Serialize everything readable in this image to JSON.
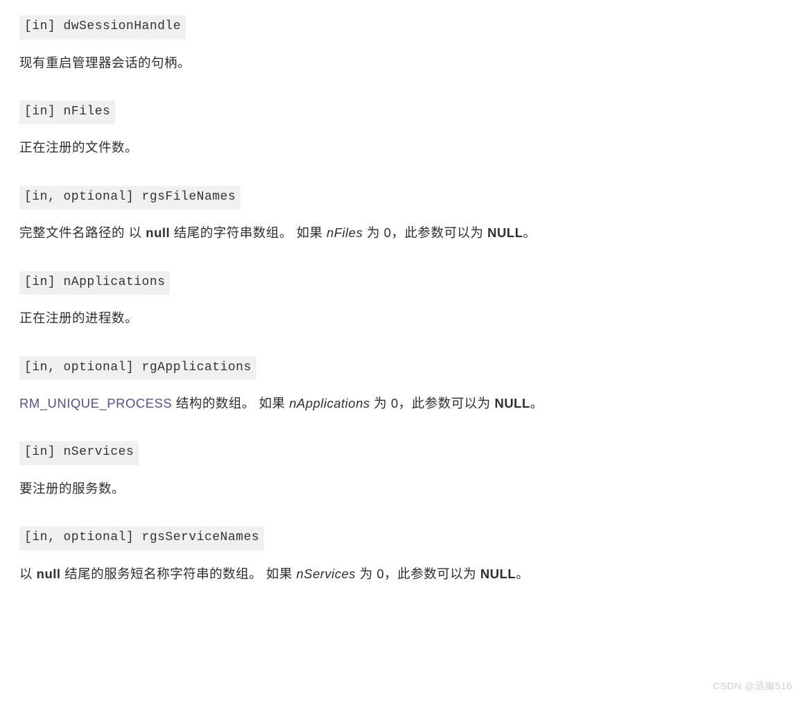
{
  "params": [
    {
      "head": "[in] dwSessionHandle",
      "desc_segments": [
        {
          "t": "现有重启管理器会话的句柄。",
          "class": ""
        }
      ]
    },
    {
      "head": "[in] nFiles",
      "desc_segments": [
        {
          "t": "正在注册的文件数。",
          "class": ""
        }
      ]
    },
    {
      "head": "[in, optional] rgsFileNames",
      "desc_segments": [
        {
          "t": "完整文件名路径的 以 ",
          "class": ""
        },
        {
          "t": "null",
          "class": "bold"
        },
        {
          "t": " 结尾的字符串数组。 如果 ",
          "class": ""
        },
        {
          "t": "nFiles",
          "class": "italic"
        },
        {
          "t": " 为 0，此参数可以为 ",
          "class": ""
        },
        {
          "t": "NULL",
          "class": "bold"
        },
        {
          "t": "。",
          "class": ""
        }
      ]
    },
    {
      "head": "[in] nApplications",
      "desc_segments": [
        {
          "t": "正在注册的进程数。",
          "class": ""
        }
      ]
    },
    {
      "head": "[in, optional] rgApplications",
      "desc_segments": [
        {
          "t": "RM_UNIQUE_PROCESS",
          "class": "plink"
        },
        {
          "t": " 结构的数组。 如果 ",
          "class": ""
        },
        {
          "t": "nApplications",
          "class": "italic"
        },
        {
          "t": " 为 0，此参数可以为 ",
          "class": ""
        },
        {
          "t": "NULL",
          "class": "bold"
        },
        {
          "t": "。",
          "class": ""
        }
      ]
    },
    {
      "head": "[in] nServices",
      "desc_segments": [
        {
          "t": "要注册的服务数。",
          "class": ""
        }
      ]
    },
    {
      "head": "[in, optional] rgsServiceNames",
      "desc_segments": [
        {
          "t": "以 ",
          "class": ""
        },
        {
          "t": "null",
          "class": "bold"
        },
        {
          "t": " 结尾的服务短名称字符串的数组。 如果 ",
          "class": ""
        },
        {
          "t": "nServices",
          "class": "italic"
        },
        {
          "t": " 为 0，此参数可以为 ",
          "class": ""
        },
        {
          "t": "NULL",
          "class": "bold"
        },
        {
          "t": "。",
          "class": ""
        }
      ]
    }
  ],
  "watermark": "CSDN @涟幽516"
}
